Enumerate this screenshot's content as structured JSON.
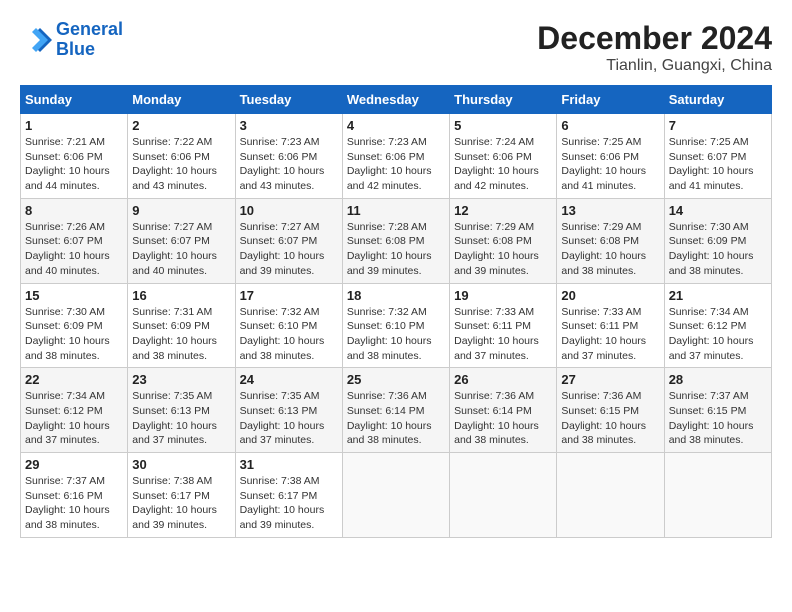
{
  "header": {
    "logo_line1": "General",
    "logo_line2": "Blue",
    "title": "December 2024",
    "subtitle": "Tianlin, Guangxi, China"
  },
  "calendar": {
    "days_of_week": [
      "Sunday",
      "Monday",
      "Tuesday",
      "Wednesday",
      "Thursday",
      "Friday",
      "Saturday"
    ],
    "weeks": [
      [
        null,
        {
          "day": "2",
          "sunrise": "Sunrise: 7:22 AM",
          "sunset": "Sunset: 6:06 PM",
          "daylight": "Daylight: 10 hours and 43 minutes."
        },
        {
          "day": "3",
          "sunrise": "Sunrise: 7:23 AM",
          "sunset": "Sunset: 6:06 PM",
          "daylight": "Daylight: 10 hours and 43 minutes."
        },
        {
          "day": "4",
          "sunrise": "Sunrise: 7:23 AM",
          "sunset": "Sunset: 6:06 PM",
          "daylight": "Daylight: 10 hours and 42 minutes."
        },
        {
          "day": "5",
          "sunrise": "Sunrise: 7:24 AM",
          "sunset": "Sunset: 6:06 PM",
          "daylight": "Daylight: 10 hours and 42 minutes."
        },
        {
          "day": "6",
          "sunrise": "Sunrise: 7:25 AM",
          "sunset": "Sunset: 6:06 PM",
          "daylight": "Daylight: 10 hours and 41 minutes."
        },
        {
          "day": "7",
          "sunrise": "Sunrise: 7:25 AM",
          "sunset": "Sunset: 6:07 PM",
          "daylight": "Daylight: 10 hours and 41 minutes."
        }
      ],
      [
        {
          "day": "1",
          "sunrise": "Sunrise: 7:21 AM",
          "sunset": "Sunset: 6:06 PM",
          "daylight": "Daylight: 10 hours and 44 minutes."
        },
        {
          "day": "9",
          "sunrise": "Sunrise: 7:27 AM",
          "sunset": "Sunset: 6:07 PM",
          "daylight": "Daylight: 10 hours and 40 minutes."
        },
        {
          "day": "10",
          "sunrise": "Sunrise: 7:27 AM",
          "sunset": "Sunset: 6:07 PM",
          "daylight": "Daylight: 10 hours and 39 minutes."
        },
        {
          "day": "11",
          "sunrise": "Sunrise: 7:28 AM",
          "sunset": "Sunset: 6:08 PM",
          "daylight": "Daylight: 10 hours and 39 minutes."
        },
        {
          "day": "12",
          "sunrise": "Sunrise: 7:29 AM",
          "sunset": "Sunset: 6:08 PM",
          "daylight": "Daylight: 10 hours and 39 minutes."
        },
        {
          "day": "13",
          "sunrise": "Sunrise: 7:29 AM",
          "sunset": "Sunset: 6:08 PM",
          "daylight": "Daylight: 10 hours and 38 minutes."
        },
        {
          "day": "14",
          "sunrise": "Sunrise: 7:30 AM",
          "sunset": "Sunset: 6:09 PM",
          "daylight": "Daylight: 10 hours and 38 minutes."
        }
      ],
      [
        {
          "day": "8",
          "sunrise": "Sunrise: 7:26 AM",
          "sunset": "Sunset: 6:07 PM",
          "daylight": "Daylight: 10 hours and 40 minutes."
        },
        {
          "day": "16",
          "sunrise": "Sunrise: 7:31 AM",
          "sunset": "Sunset: 6:09 PM",
          "daylight": "Daylight: 10 hours and 38 minutes."
        },
        {
          "day": "17",
          "sunrise": "Sunrise: 7:32 AM",
          "sunset": "Sunset: 6:10 PM",
          "daylight": "Daylight: 10 hours and 38 minutes."
        },
        {
          "day": "18",
          "sunrise": "Sunrise: 7:32 AM",
          "sunset": "Sunset: 6:10 PM",
          "daylight": "Daylight: 10 hours and 38 minutes."
        },
        {
          "day": "19",
          "sunrise": "Sunrise: 7:33 AM",
          "sunset": "Sunset: 6:11 PM",
          "daylight": "Daylight: 10 hours and 37 minutes."
        },
        {
          "day": "20",
          "sunrise": "Sunrise: 7:33 AM",
          "sunset": "Sunset: 6:11 PM",
          "daylight": "Daylight: 10 hours and 37 minutes."
        },
        {
          "day": "21",
          "sunrise": "Sunrise: 7:34 AM",
          "sunset": "Sunset: 6:12 PM",
          "daylight": "Daylight: 10 hours and 37 minutes."
        }
      ],
      [
        {
          "day": "15",
          "sunrise": "Sunrise: 7:30 AM",
          "sunset": "Sunset: 6:09 PM",
          "daylight": "Daylight: 10 hours and 38 minutes."
        },
        {
          "day": "23",
          "sunrise": "Sunrise: 7:35 AM",
          "sunset": "Sunset: 6:13 PM",
          "daylight": "Daylight: 10 hours and 37 minutes."
        },
        {
          "day": "24",
          "sunrise": "Sunrise: 7:35 AM",
          "sunset": "Sunset: 6:13 PM",
          "daylight": "Daylight: 10 hours and 37 minutes."
        },
        {
          "day": "25",
          "sunrise": "Sunrise: 7:36 AM",
          "sunset": "Sunset: 6:14 PM",
          "daylight": "Daylight: 10 hours and 38 minutes."
        },
        {
          "day": "26",
          "sunrise": "Sunrise: 7:36 AM",
          "sunset": "Sunset: 6:14 PM",
          "daylight": "Daylight: 10 hours and 38 minutes."
        },
        {
          "day": "27",
          "sunrise": "Sunrise: 7:36 AM",
          "sunset": "Sunset: 6:15 PM",
          "daylight": "Daylight: 10 hours and 38 minutes."
        },
        {
          "day": "28",
          "sunrise": "Sunrise: 7:37 AM",
          "sunset": "Sunset: 6:15 PM",
          "daylight": "Daylight: 10 hours and 38 minutes."
        }
      ],
      [
        {
          "day": "22",
          "sunrise": "Sunrise: 7:34 AM",
          "sunset": "Sunset: 6:12 PM",
          "daylight": "Daylight: 10 hours and 37 minutes."
        },
        {
          "day": "30",
          "sunrise": "Sunrise: 7:38 AM",
          "sunset": "Sunset: 6:17 PM",
          "daylight": "Daylight: 10 hours and 39 minutes."
        },
        {
          "day": "31",
          "sunrise": "Sunrise: 7:38 AM",
          "sunset": "Sunset: 6:17 PM",
          "daylight": "Daylight: 10 hours and 39 minutes."
        },
        null,
        null,
        null,
        null
      ],
      [
        {
          "day": "29",
          "sunrise": "Sunrise: 7:37 AM",
          "sunset": "Sunset: 6:16 PM",
          "daylight": "Daylight: 10 hours and 38 minutes."
        },
        null,
        null,
        null,
        null,
        null,
        null
      ]
    ]
  }
}
